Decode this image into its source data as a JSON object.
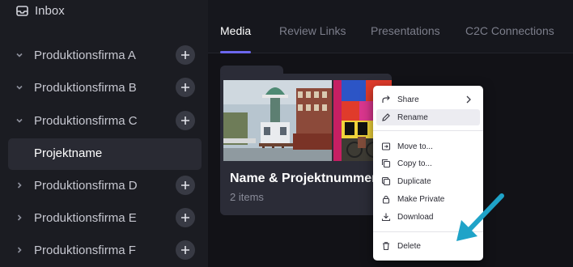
{
  "sidebar": {
    "inbox": "Inbox",
    "projects": [
      {
        "label": "Produktionsfirma A",
        "expanded": true
      },
      {
        "label": "Produktionsfirma B",
        "expanded": true
      },
      {
        "label": "Produktionsfirma C",
        "expanded": true
      },
      {
        "label": "Produktionsfirma D",
        "expanded": false
      },
      {
        "label": "Produktionsfirma E",
        "expanded": false
      },
      {
        "label": "Produktionsfirma F",
        "expanded": false
      }
    ],
    "selected_item": "Projektname"
  },
  "tabs": [
    {
      "label": "Media",
      "active": true
    },
    {
      "label": "Review Links",
      "active": false
    },
    {
      "label": "Presentations",
      "active": false
    },
    {
      "label": "C2C Connections",
      "active": false
    }
  ],
  "folder": {
    "name": "Name & Projektnummer",
    "count": "2 items"
  },
  "context_menu": {
    "share": "Share",
    "rename": "Rename",
    "move_to": "Move to...",
    "copy_to": "Copy to...",
    "duplicate": "Duplicate",
    "make_private": "Make Private",
    "download": "Download",
    "delete": "Delete"
  },
  "colors": {
    "accent": "#6c67ee",
    "arrow": "#1fa3c8",
    "sidebar_bg": "#1b1c22",
    "main_bg": "#121217"
  }
}
